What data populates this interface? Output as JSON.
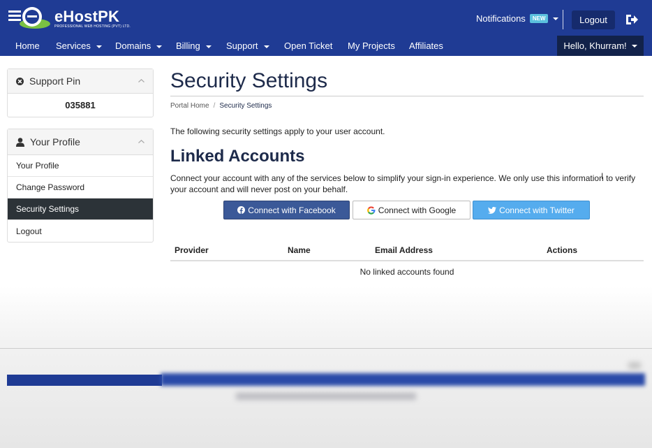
{
  "header": {
    "brand": "eHostPK",
    "brand_tagline": "PROFESSIONAL WEB HOSTING (PVT) LTD.",
    "notifications_label": "Notifications",
    "notifications_badge": "NEW",
    "logout_label": "Logout"
  },
  "nav": {
    "items": [
      {
        "label": "Home"
      },
      {
        "label": "Services"
      },
      {
        "label": "Domains"
      },
      {
        "label": "Billing"
      },
      {
        "label": "Support"
      },
      {
        "label": "Open Ticket"
      },
      {
        "label": "My Projects"
      },
      {
        "label": "Affiliates"
      }
    ],
    "user_menu": "Hello, Khurram!"
  },
  "sidebar": {
    "support_pin": {
      "title": "Support Pin",
      "value": "035881"
    },
    "profile": {
      "title": "Your Profile",
      "items": [
        {
          "label": "Your Profile"
        },
        {
          "label": "Change Password"
        },
        {
          "label": "Security Settings"
        },
        {
          "label": "Logout"
        }
      ]
    }
  },
  "main": {
    "title": "Security Settings",
    "breadcrumb": {
      "home": "Portal Home",
      "separator": "/",
      "current": "Security Settings"
    },
    "intro": "The following security settings apply to your user account.",
    "linked_title": "Linked Accounts",
    "linked_desc": "Connect your account with any of the services below to simplify your sign-in experience. We only use this information to verify your account and will never post on your behalf.",
    "buttons": {
      "facebook": "Connect with Facebook",
      "google": "Connect with Google",
      "twitter": "Connect with Twitter"
    },
    "table": {
      "headers": [
        "Provider",
        "Name",
        "Email Address",
        "Actions"
      ],
      "empty_message": "No linked accounts found"
    }
  },
  "colors": {
    "brand_blue": "#1f3b94",
    "active_menu": "#2c3338",
    "facebook": "#3b5998",
    "twitter": "#55acee",
    "badge": "#5bc0de"
  }
}
